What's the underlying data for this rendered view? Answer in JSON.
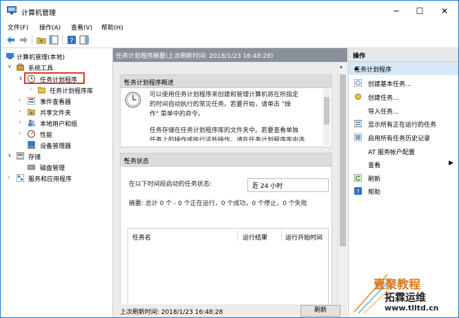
{
  "window": {
    "title": "计算机管理",
    "minimize": "─",
    "maximize": "☐",
    "close": "✕"
  },
  "menu": [
    "文件(F)",
    "操作(A)",
    "查看(V)",
    "帮助(H)"
  ],
  "tree": {
    "root": "计算机管理(本地)",
    "system_tools": "系统工具",
    "task_scheduler": "任务计划程序",
    "task_library": "任务计划程序库",
    "event_viewer": "事件查看器",
    "shared_folders": "共享文件夹",
    "local_users": "本地用户和组",
    "performance": "性能",
    "device_manager": "设备管理器",
    "storage": "存储",
    "disk_management": "磁盘管理",
    "services_apps": "服务和应用程序"
  },
  "center": {
    "header": "任务计划程序摘要(上次刷新时间: 2018/1/23 16:48:28)",
    "overview": {
      "title": "任务计划程序概述",
      "line1": "可以使用任务计划程序来创建和管理计算机将在所指定",
      "line2": "的时间自动执行的常见任务。若要开始，请单击 \"操",
      "line3": "作\" 菜单中的命令。",
      "line4": "任务存储在任务计划程序库的文件夹中。若要查看单独",
      "line5": "任务上的操作或执行这些操作，请在任务计划程序库中选"
    },
    "status": {
      "title": "任务状态",
      "label": "在以下时间段启动的任务状态:",
      "selected": "近 24 小时",
      "summary": "摘要: 总计 0 个 - 0 个正在运行，0 个成功，0 个停止，0 个失败",
      "columns": [
        "任务名",
        "运行结果",
        "运行开始时间"
      ]
    },
    "footer": "上次刷新时间: 2018/1/23 16:48:28",
    "refresh": "刷新"
  },
  "actions": {
    "header": "操作",
    "section": "任务计划程序",
    "items": [
      "创建基本任务...",
      "创建任务...",
      "导入任务...",
      "显示所有正在运行的任务",
      "启用所有任务历史记录",
      "AT 服务帐户配置",
      "查看",
      "刷新",
      "帮助"
    ]
  },
  "watermark": {
    "line1": "壹聚教程",
    "line2": "拓霖运维",
    "line3": "www.tlltd.cn"
  },
  "colors": {
    "accent_border": "#1a79c8",
    "highlight_box": "#e0332c",
    "header_gray": "#8a9099",
    "action_selected": "#d6e7f7"
  }
}
